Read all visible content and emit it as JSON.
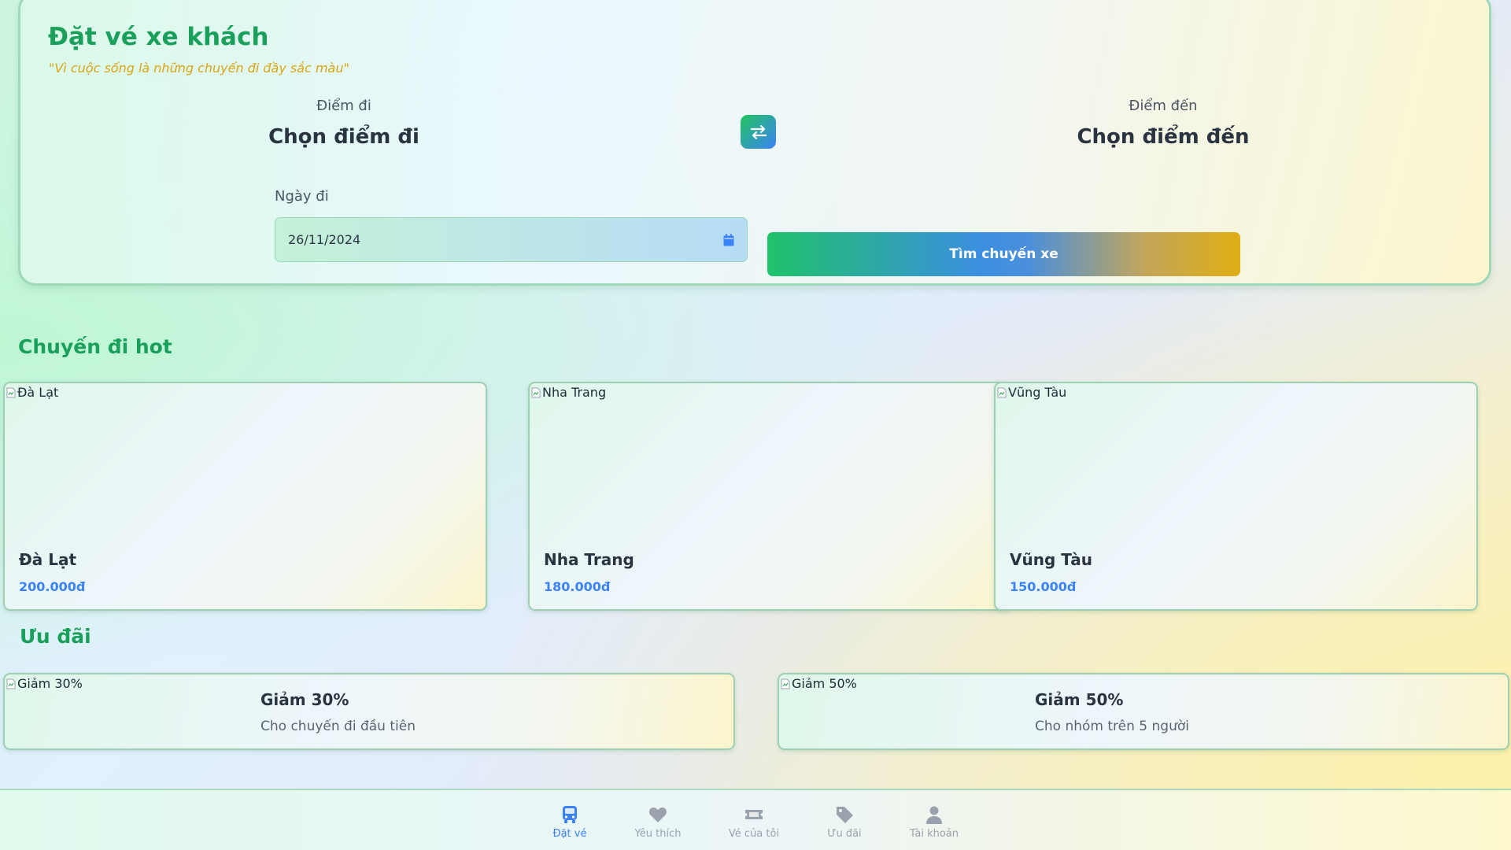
{
  "booking": {
    "title": "Đặt vé xe khách",
    "slogan": "\"Vì cuộc sống là những chuyến đi đầy sắc màu\"",
    "origin": {
      "label": "Điểm đi",
      "value": "Chọn điểm đi"
    },
    "destination": {
      "label": "Điểm đến",
      "value": "Chọn điểm đến"
    },
    "swap_icon": "swap-arrows-icon",
    "date": {
      "label": "Ngày đi",
      "value": "26/11/2024",
      "icon": "calendar-icon"
    },
    "search_label": "Tìm chuyến xe"
  },
  "hot_trips": {
    "title": "Chuyến đi hot",
    "items": [
      {
        "image_alt": "Đà Lạt",
        "name": "Đà Lạt",
        "price": "200.000đ"
      },
      {
        "image_alt": "Nha Trang",
        "name": "Nha Trang",
        "price": "180.000đ"
      },
      {
        "image_alt": "Vũng Tàu",
        "name": "Vũng Tàu",
        "price": "150.000đ"
      }
    ]
  },
  "offers": {
    "title": "Ưu đãi",
    "items": [
      {
        "image_alt": "Giảm 30%",
        "title": "Giảm 30%",
        "description": "Cho chuyến đi đầu tiên"
      },
      {
        "image_alt": "Giảm 50%",
        "title": "Giảm 50%",
        "description": "Cho nhóm trên 5 người"
      }
    ]
  },
  "nav": {
    "items": [
      {
        "label": "Đặt vé",
        "icon": "bus-icon",
        "active": true
      },
      {
        "label": "Yêu thích",
        "icon": "heart-icon",
        "active": false
      },
      {
        "label": "Vé của tôi",
        "icon": "ticket-icon",
        "active": false
      },
      {
        "label": "Ưu đãi",
        "icon": "tag-icon",
        "active": false
      },
      {
        "label": "Tài khoản",
        "icon": "user-icon",
        "active": false
      }
    ]
  },
  "colors": {
    "brand_green": "#1aa05a",
    "accent_blue": "#3b82f6",
    "accent_gold": "#e0ae14",
    "slogan_gold": "#d9a514",
    "nav_inactive": "#9aa3ad"
  }
}
